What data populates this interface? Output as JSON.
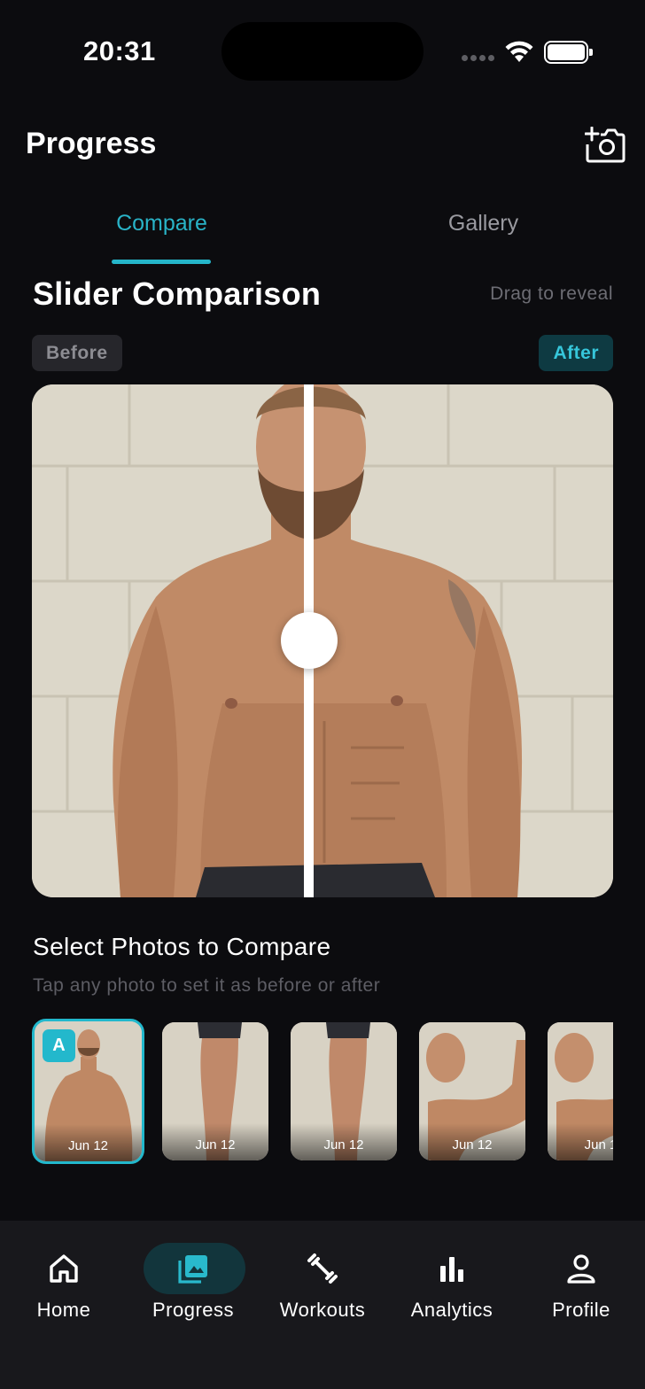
{
  "status_bar": {
    "time": "20:31"
  },
  "header": {
    "title": "Progress",
    "add_photo_icon": "camera-plus-icon"
  },
  "tabs": [
    {
      "label": "Compare",
      "active": true
    },
    {
      "label": "Gallery",
      "active": false
    }
  ],
  "comparison": {
    "title": "Slider Comparison",
    "hint": "Drag to reveal",
    "before_label": "Before",
    "after_label": "After",
    "slider_position": 0.48
  },
  "photo_picker": {
    "title": "Select Photos to Compare",
    "subtitle": "Tap any photo to set it as before or after",
    "photos": [
      {
        "date": "Jun 12",
        "badge": "A",
        "selected": true
      },
      {
        "date": "Jun 12"
      },
      {
        "date": "Jun 12"
      },
      {
        "date": "Jun 12"
      },
      {
        "date": "Jun 1"
      }
    ]
  },
  "nav": [
    {
      "label": "Home",
      "icon": "home-icon",
      "active": false
    },
    {
      "label": "Progress",
      "icon": "photo-icon",
      "active": true
    },
    {
      "label": "Workouts",
      "icon": "dumbbell-icon",
      "active": false
    },
    {
      "label": "Analytics",
      "icon": "bar-chart-icon",
      "active": false
    },
    {
      "label": "Profile",
      "icon": "person-icon",
      "active": false
    }
  ],
  "colors": {
    "accent": "#25b6ca",
    "background": "#0c0c0f",
    "tabbar": "#18181c"
  }
}
